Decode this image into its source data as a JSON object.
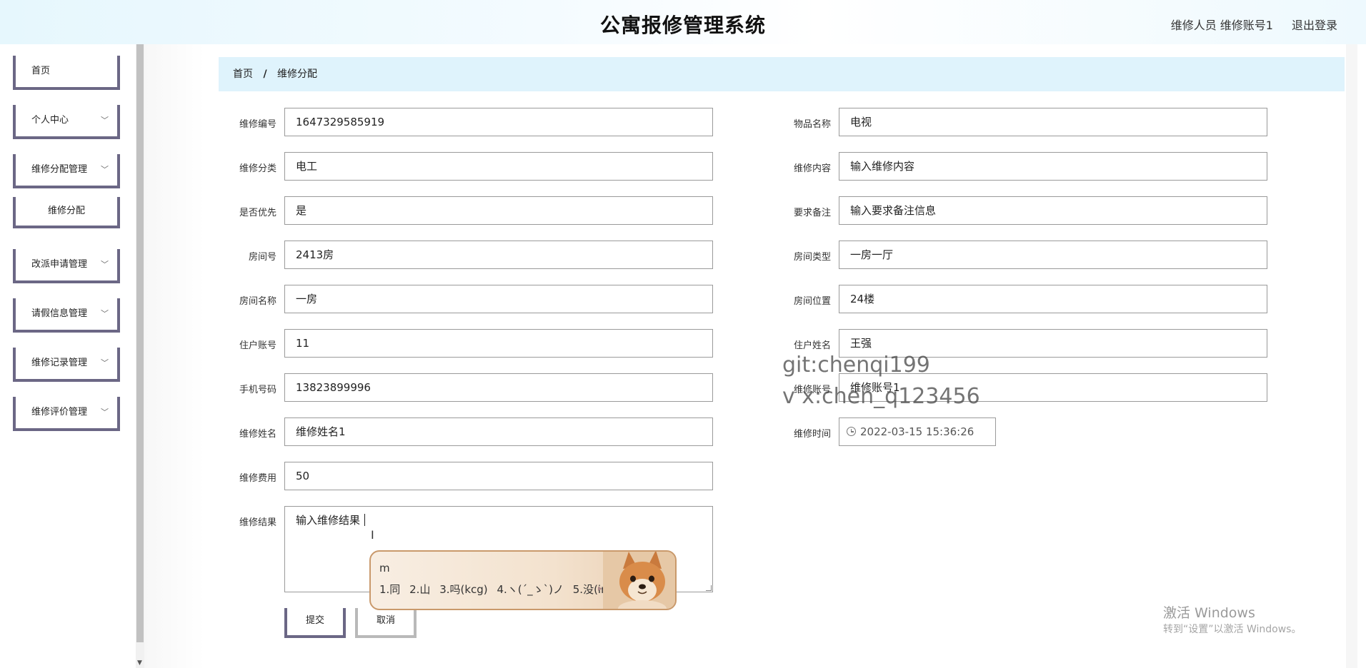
{
  "header": {
    "title": "公寓报修管理系统",
    "user": "维修人员 维修账号1",
    "logout": "退出登录"
  },
  "sidebar": {
    "items": [
      {
        "label": "首页"
      },
      {
        "label": "个人中心"
      },
      {
        "label": "维修分配管理"
      },
      {
        "label": "维修分配"
      },
      {
        "label": "改派申请管理"
      },
      {
        "label": "请假信息管理"
      },
      {
        "label": "维修记录管理"
      },
      {
        "label": "维修评价管理"
      }
    ],
    "chevron": "﹀"
  },
  "breadcrumb": {
    "home": "首页",
    "sep": "/",
    "current": "维修分配"
  },
  "form": {
    "left": [
      {
        "label": "维修编号",
        "value": "1647329585919"
      },
      {
        "label": "维修分类",
        "value": "电工"
      },
      {
        "label": "是否优先",
        "value": "是"
      },
      {
        "label": "房间号",
        "value": "2413房"
      },
      {
        "label": "房间名称",
        "value": "一房"
      },
      {
        "label": "住户账号",
        "value": "11"
      },
      {
        "label": "手机号码",
        "value": "13823899996"
      },
      {
        "label": "维修姓名",
        "value": "维修姓名1"
      },
      {
        "label": "维修费用",
        "value": "50"
      }
    ],
    "right": [
      {
        "label": "物品名称",
        "value": "电视"
      },
      {
        "label": "维修内容",
        "value": "输入维修内容"
      },
      {
        "label": "要求备注",
        "value": "输入要求备注信息"
      },
      {
        "label": "房间类型",
        "value": "一房一厅"
      },
      {
        "label": "房间位置",
        "value": "24楼"
      },
      {
        "label": "住户姓名",
        "value": "王强"
      },
      {
        "label": "维修账号",
        "value": "维修账号1"
      },
      {
        "label": "维修时间",
        "value": "2022-03-15 15:36:26"
      }
    ],
    "result": {
      "label": "维修结果",
      "value": "输入维修结果"
    },
    "submit": "提交",
    "cancel": "取消"
  },
  "ime": {
    "code": "m",
    "candidates": [
      "1.同",
      "2.山",
      "3.吗(kcg)",
      "4.ヽ(´_ゝ`)ノ",
      "5.没(imcy)"
    ],
    "arrow": "▸"
  },
  "watermark": {
    "line1": "git:chenqi199",
    "line2": "v x:chen_q123456"
  },
  "activation": {
    "line1": "激活 Windows",
    "line2": "转到“设置”以激活 Windows。"
  },
  "colors": {
    "accent_border": "#6b6785",
    "breadcrumb_bg": "#dff3fc"
  }
}
